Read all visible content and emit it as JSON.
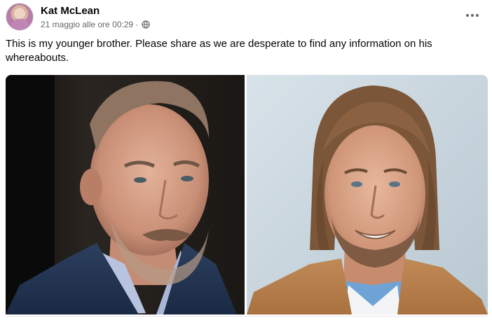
{
  "post": {
    "author": "Kat McLean",
    "date": "21 maggio alle ore 00:29",
    "separator": "·",
    "privacy_icon": "globe-icon",
    "more_icon": "more-options-icon",
    "caption": "This is my younger brother. Please share as we are desperate to find any information on his whereabouts.",
    "photos": [
      {
        "icon": "man-portrait-dark-background"
      },
      {
        "icon": "man-portrait-light-background"
      }
    ]
  },
  "colors": {
    "secondary_text": "#65676b",
    "primary_text": "#050505",
    "left_photo_bg": "#1c1a17",
    "right_photo_bg": "#c7d4dc"
  }
}
